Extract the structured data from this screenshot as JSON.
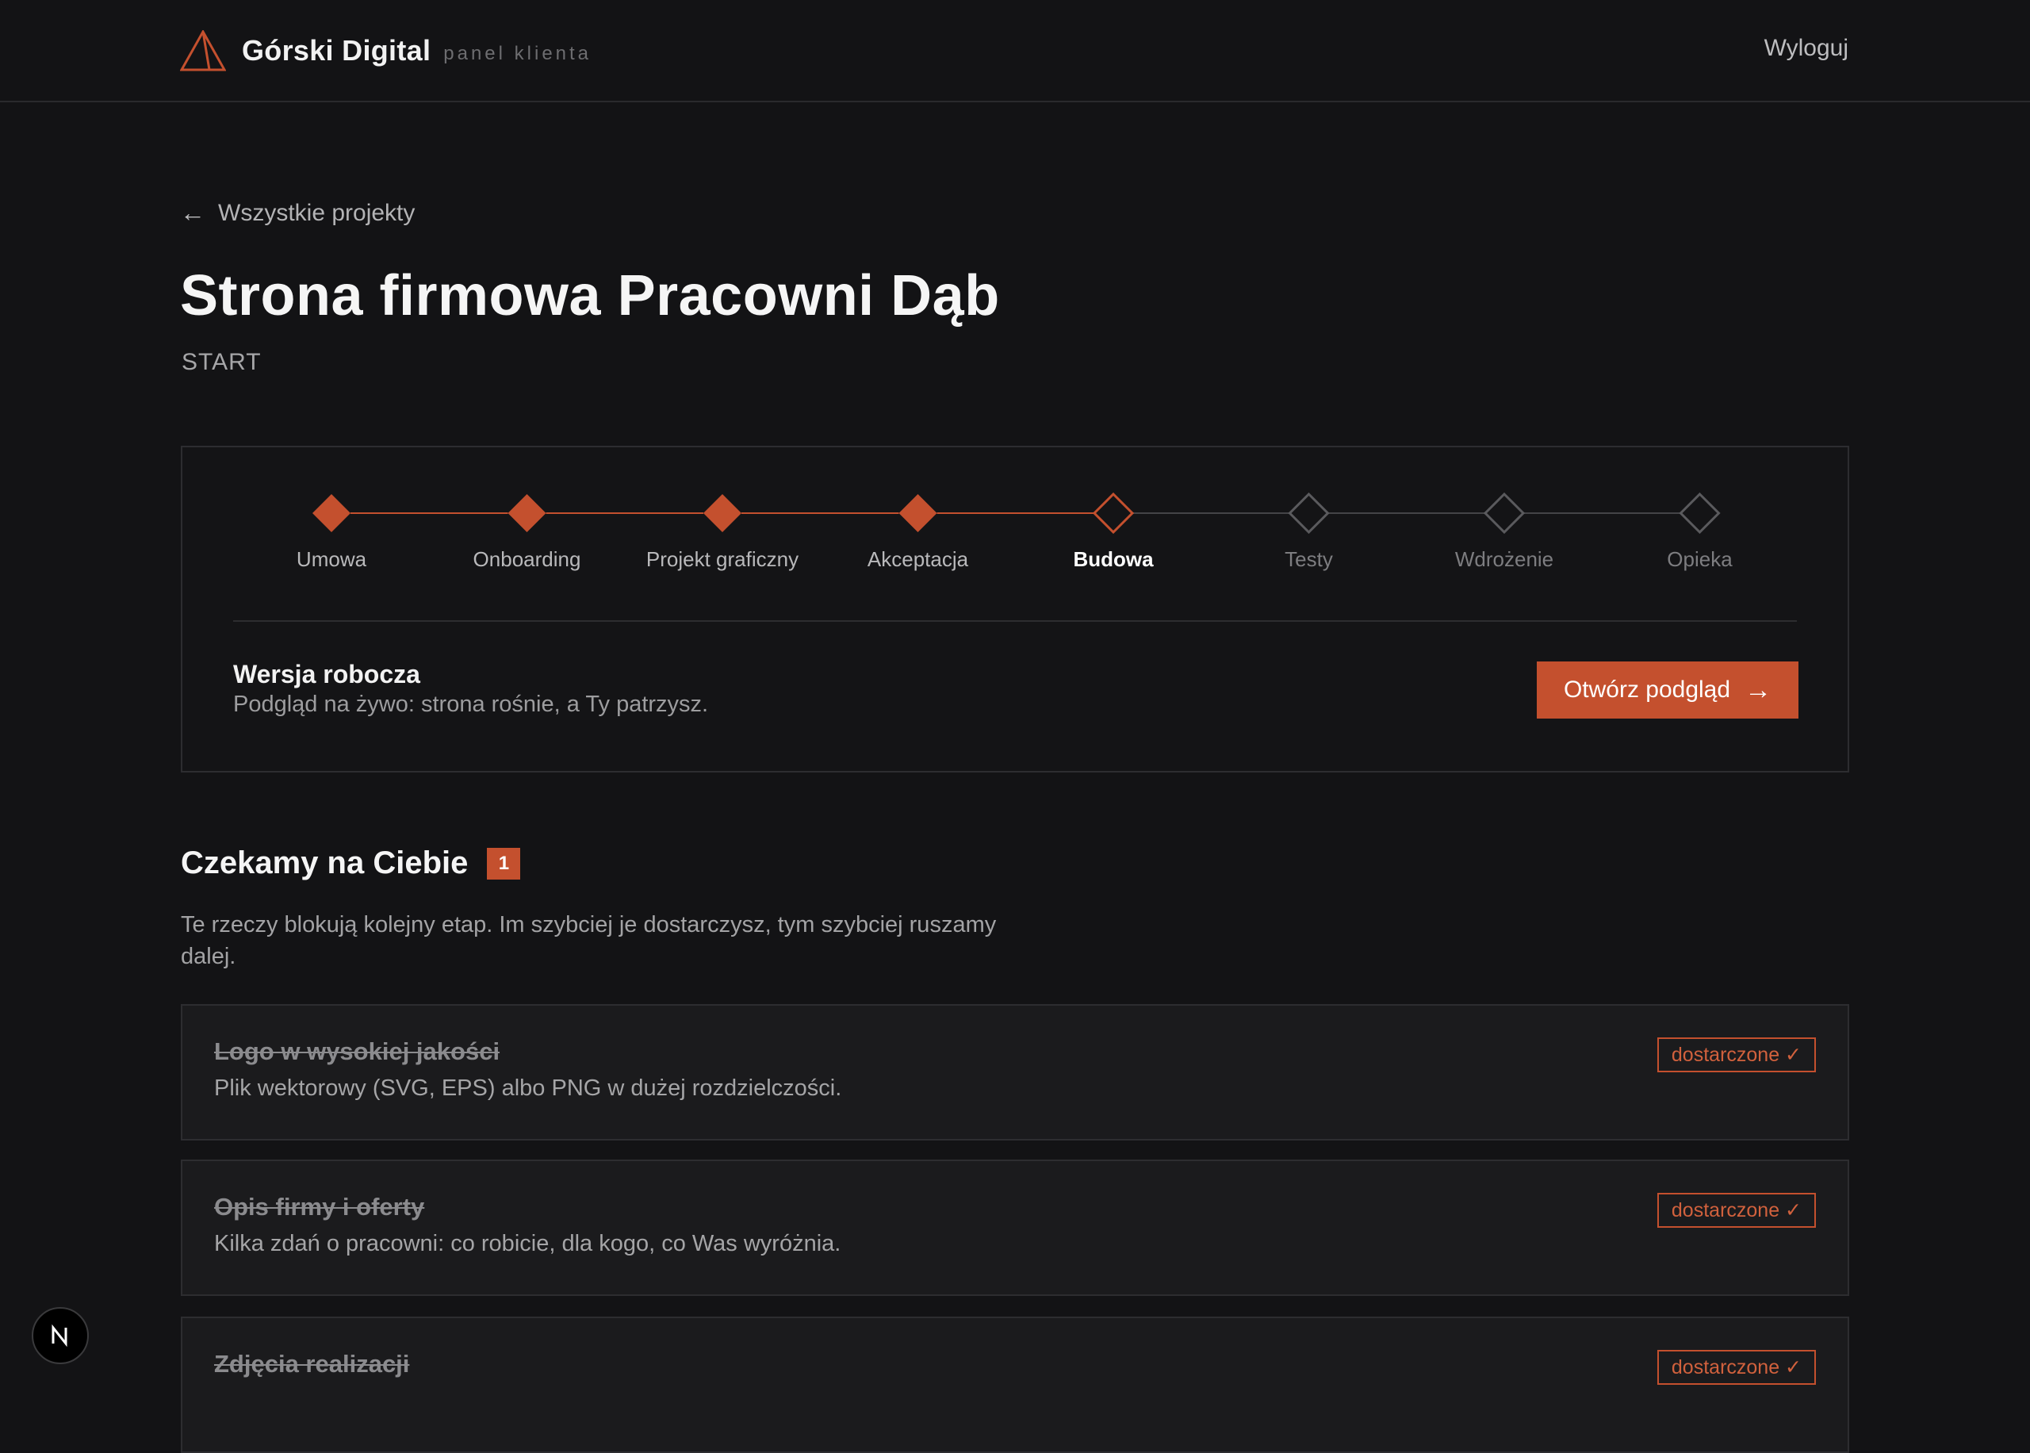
{
  "header": {
    "brand_name": "Górski Digital",
    "brand_sub": "panel klienta",
    "logout_label": "Wyloguj"
  },
  "nav": {
    "back_label": "Wszystkie projekty"
  },
  "project": {
    "title": "Strona firmowa Pracowni Dąb",
    "stage": "START"
  },
  "timeline": {
    "steps": [
      {
        "label": "Umowa",
        "state": "done"
      },
      {
        "label": "Onboarding",
        "state": "done"
      },
      {
        "label": "Projekt graficzny",
        "state": "done"
      },
      {
        "label": "Akceptacja",
        "state": "done"
      },
      {
        "label": "Budowa",
        "state": "current"
      },
      {
        "label": "Testy",
        "state": "future"
      },
      {
        "label": "Wdrożenie",
        "state": "future"
      },
      {
        "label": "Opieka",
        "state": "future"
      }
    ]
  },
  "draft": {
    "title": "Wersja robocza",
    "description": "Podgląd na żywo: strona rośnie, a Ty patrzysz.",
    "button_label": "Otwórz podgląd"
  },
  "waiting": {
    "title": "Czekamy na Ciebie",
    "count": "1",
    "description": "Te rzeczy blokują kolejny etap. Im szybciej je dostarczysz, tym szybciej ruszamy dalej.",
    "tasks": [
      {
        "title": "Logo w wysokiej jakości",
        "description": "Plik wektorowy (SVG, EPS) albo PNG w dużej rozdzielczości.",
        "status": "dostarczone ✓"
      },
      {
        "title": "Opis firmy i oferty",
        "description": "Kilka zdań o pracowni: co robicie, dla kogo, co Was wyróżnia.",
        "status": "dostarczone ✓"
      },
      {
        "title": "Zdjęcia realizacji",
        "description": "",
        "status": "dostarczone ✓"
      }
    ]
  },
  "colors": {
    "accent": "#c4502e",
    "background": "#131315"
  }
}
